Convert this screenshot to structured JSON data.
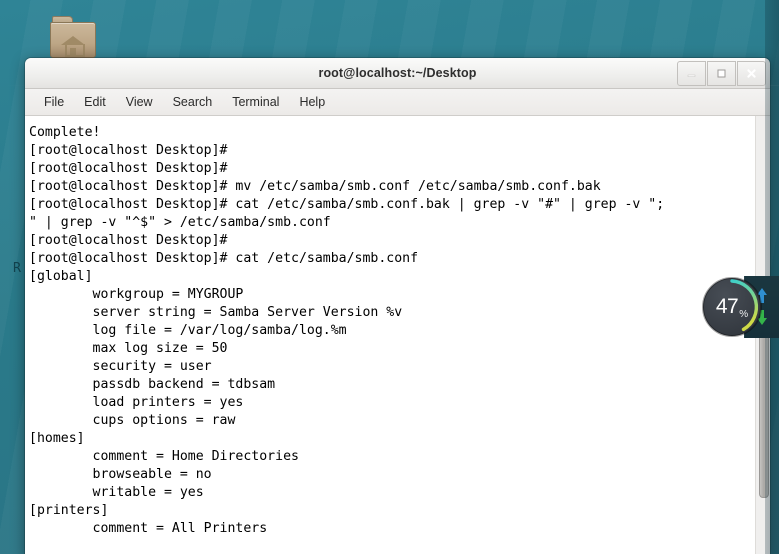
{
  "desktop": {
    "background_color": "#2d7f8e",
    "icons": [
      {
        "name": "home-folder",
        "label": "",
        "glyph": "home-folder-icon"
      }
    ],
    "edge_glyph": "R"
  },
  "window": {
    "title": "root@localhost:~/Desktop",
    "controls": {
      "minimize": "minimize-icon",
      "maximize": "maximize-icon",
      "close": "close-icon"
    }
  },
  "menu": {
    "items": [
      {
        "label": "File"
      },
      {
        "label": "Edit"
      },
      {
        "label": "View"
      },
      {
        "label": "Search"
      },
      {
        "label": "Terminal"
      },
      {
        "label": "Help"
      }
    ]
  },
  "terminal": {
    "text": "Complete!\n[root@localhost Desktop]#\n[root@localhost Desktop]#\n[root@localhost Desktop]# mv /etc/samba/smb.conf /etc/samba/smb.conf.bak\n[root@localhost Desktop]# cat /etc/samba/smb.conf.bak | grep -v \"#\" | grep -v \";\n\" | grep -v \"^$\" > /etc/samba/smb.conf\n[root@localhost Desktop]#\n[root@localhost Desktop]# cat /etc/samba/smb.conf\n[global]\n        workgroup = MYGROUP\n        server string = Samba Server Version %v\n        log file = /var/log/samba/log.%m\n        max log size = 50\n        security = user\n        passdb backend = tdbsam\n        load printers = yes\n        cups options = raw\n[homes]\n        comment = Home Directories\n        browseable = no\n        writable = yes\n[printers]\n        comment = All Printers",
    "lines": [
      "Complete!",
      "[root@localhost Desktop]#",
      "[root@localhost Desktop]#",
      "[root@localhost Desktop]# mv /etc/samba/smb.conf /etc/samba/smb.conf.bak",
      "[root@localhost Desktop]# cat /etc/samba/smb.conf.bak | grep -v \"#\" | grep -v \";",
      "\" | grep -v \"^$\" > /etc/samba/smb.conf",
      "[root@localhost Desktop]#",
      "[root@localhost Desktop]# cat /etc/samba/smb.conf",
      "[global]",
      "        workgroup = MYGROUP",
      "        server string = Samba Server Version %v",
      "        log file = /var/log/samba/log.%m",
      "        max log size = 50",
      "        security = user",
      "        passdb backend = tdbsam",
      "        load printers = yes",
      "        cups options = raw",
      "[homes]",
      "        comment = Home Directories",
      "        browseable = no",
      "        writable = yes",
      "[printers]",
      "        comment = All Printers"
    ],
    "foreground_color": "#000000",
    "background_color": "#ffffff"
  },
  "scrollbar": {
    "thumb_top_percent": 45,
    "thumb_height_percent": 41
  },
  "progress_widget": {
    "value": "47",
    "unit": "%",
    "percent": 47,
    "arc_start_color": "#3fd0c9",
    "arc_end_color": "#c8d94a",
    "dial_color": "#3a3f46"
  },
  "net_panel": {
    "upload_icon": "upload-arrow-icon",
    "upload_color": "#2f8fd0",
    "download_icon": "download-arrow-icon",
    "download_color": "#34b54a"
  }
}
